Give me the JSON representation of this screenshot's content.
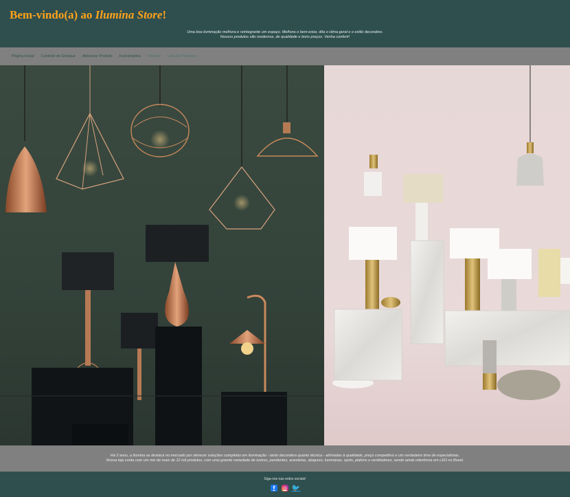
{
  "header": {
    "welcome": "Bem-vindo(a) ao ",
    "store_name": "Ilumina Store",
    "exclaim": "!",
    "tagline_line1": "Uma boa iluminação melhora e reintegrante um espaço. Melhora o bem-estar, dita o clima geral e o estilo decorativo.",
    "tagline_line2": "Nossos produtos são modernos, de qualidade e bons preços. Venha conferir!"
  },
  "nav": {
    "items": [
      {
        "label": "Página Inicial"
      },
      {
        "label": "Controle de Estoque"
      },
      {
        "label": "Adicionar Produto"
      },
      {
        "label": "Funcionários"
      },
      {
        "label": "Vendas"
      },
      {
        "label": "Lista de Produtos"
      }
    ]
  },
  "about": {
    "line1": "Há 2 anos, a Ilumina se destaca no mercado por oferecer soluções completas em iluminação - tanto decorativa quanto técnica - alinhadas à qualidade, preço competitivo e um verdadeiro time de especialistas.",
    "line2": "Nossa loja conta com um mix de mais de 12 mil produtos, com uma grande variedade de lustres, pendentes, arandelas, abajures, luminárias, spots, plafons e ventiladores, sendo ainda referência em LED no Brasil."
  },
  "footer": {
    "follow_text": "Siga-nos nas redes sociais!",
    "socials": [
      {
        "icon": "facebook-icon",
        "glyph": "f",
        "color": "#1877f2"
      },
      {
        "icon": "instagram-icon",
        "glyph": "◎",
        "color": "#e1306c"
      },
      {
        "icon": "twitter-icon",
        "glyph": "🐦",
        "color": "#1da1f2"
      }
    ]
  },
  "colors": {
    "header_bg": "#2f4f4f",
    "brand": "#ffa31a",
    "nav_bg": "#808080"
  }
}
